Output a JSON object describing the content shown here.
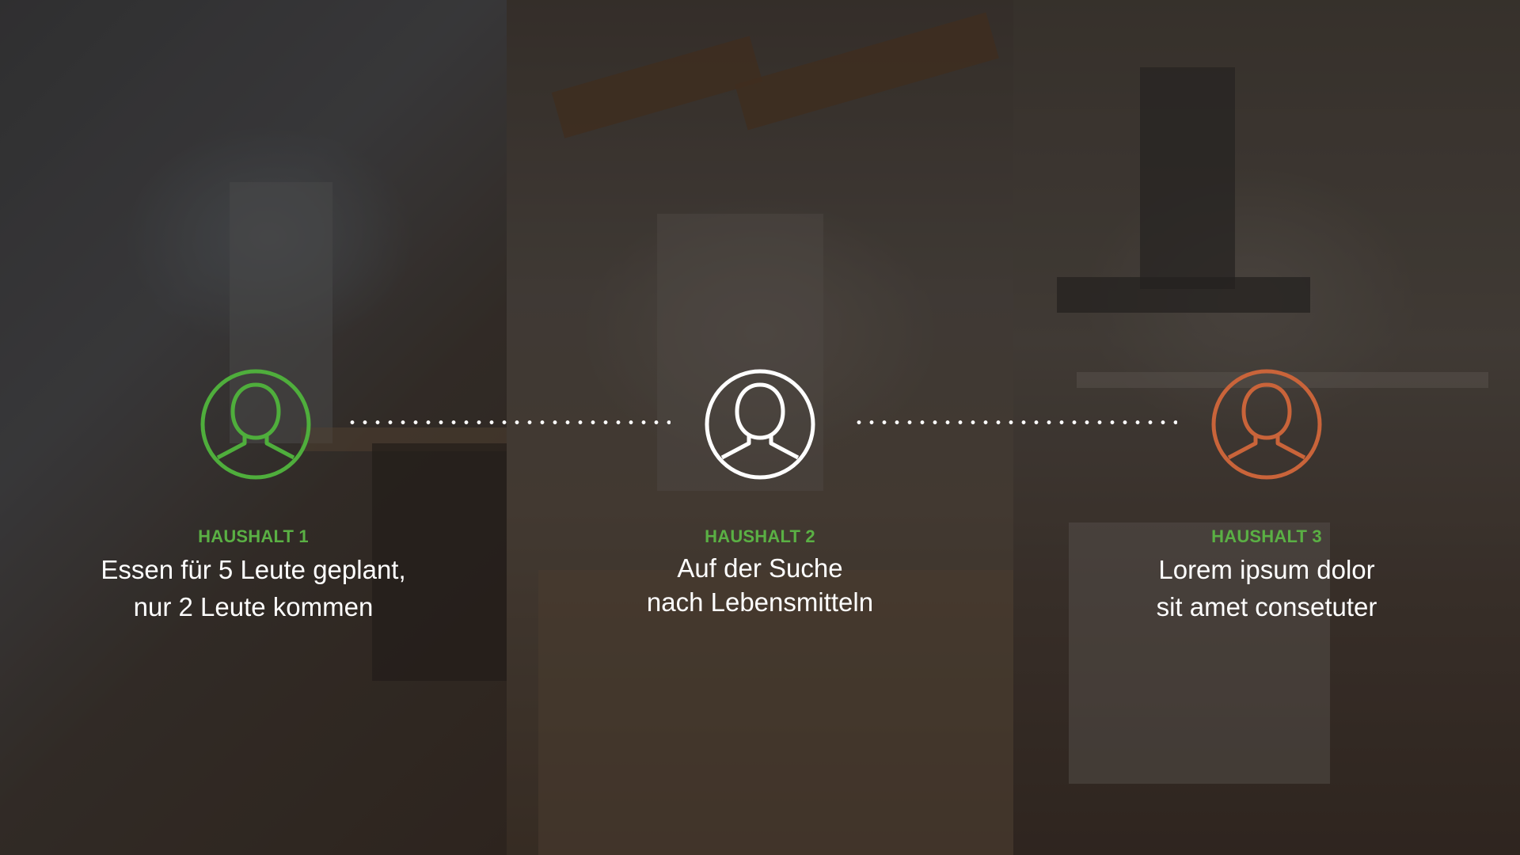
{
  "households": [
    {
      "title": "HAUSHALT 1",
      "line1": "Essen für 5 Leute geplant,",
      "line2": "nur 2 Leute kommen",
      "icon": "user-icon",
      "icon_color": "#4fae3c"
    },
    {
      "title": "HAUSHALT 2",
      "line1": "Auf der Suche",
      "line2": "nach Lebensmitteln",
      "icon": "user-icon",
      "icon_color": "#ffffff"
    },
    {
      "title": "HAUSHALT 3",
      "line1": "Lorem ipsum dolor",
      "line2": "sit amet consetuter",
      "icon": "user-icon",
      "icon_color": "#c9643a"
    }
  ],
  "colors": {
    "title_green": "#5ab044",
    "text_white": "#ffffff",
    "connector": "#ffffff"
  }
}
